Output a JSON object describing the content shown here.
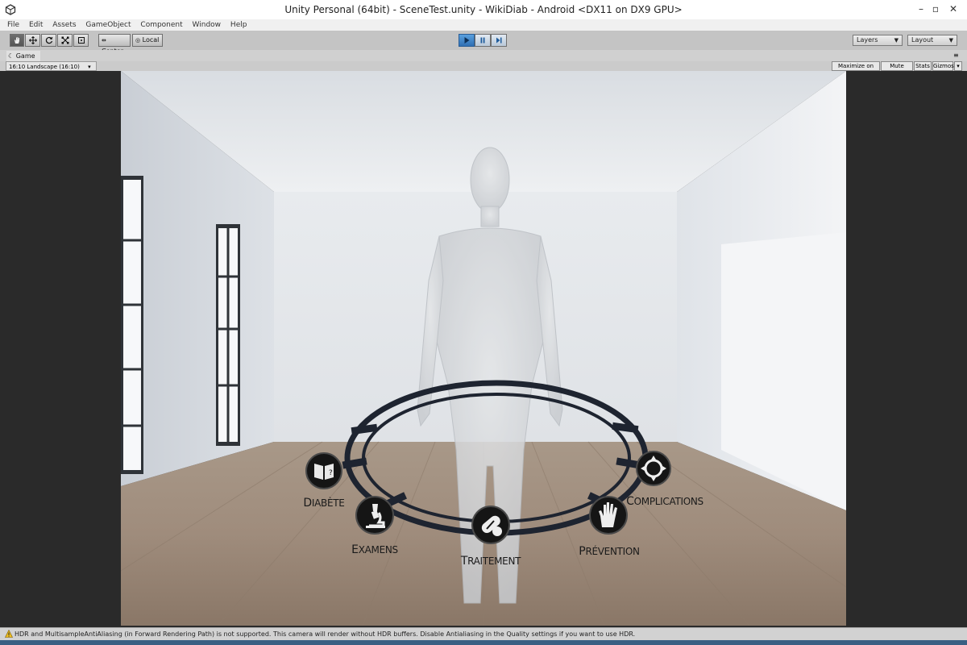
{
  "window": {
    "title": "Unity Personal (64bit) - SceneTest.unity - WikiDiab - Android <DX11 on DX9 GPU>",
    "controls": {
      "minimize": "–",
      "maximize": "▫",
      "close": "✕"
    }
  },
  "menubar": {
    "items": [
      "File",
      "Edit",
      "Assets",
      "GameObject",
      "Component",
      "Window",
      "Help"
    ]
  },
  "toolbar": {
    "pivot_mode": "Center",
    "pivot_space": "Local",
    "layers_label": "Layers",
    "layout_label": "Layout"
  },
  "game_view": {
    "tab_label": "Game",
    "resolution": "16:10 Landscape (16:10)",
    "buttons": {
      "maximize_on_play": "Maximize on Play",
      "mute_audio": "Mute audio",
      "stats": "Stats",
      "gizmos": "Gizmos"
    }
  },
  "ring_menu": {
    "items": [
      {
        "first": "D",
        "rest": "IABÈTE",
        "icon": "book-icon"
      },
      {
        "first": "E",
        "rest": "XAMENS",
        "icon": "microscope-icon"
      },
      {
        "first": "T",
        "rest": "RAITEMENT",
        "icon": "pill-icon"
      },
      {
        "first": "P",
        "rest": "RÉVENTION",
        "icon": "hand-icon"
      },
      {
        "first": "C",
        "rest": "OMPLICATIONS",
        "icon": "target-icon"
      }
    ]
  },
  "status": {
    "message": "HDR and MultisampleAntiAliasing (in Forward Rendering Path) is not supported. This camera will render without HDR buffers. Disable Antialiasing in the Quality settings if you want to use HDR."
  }
}
